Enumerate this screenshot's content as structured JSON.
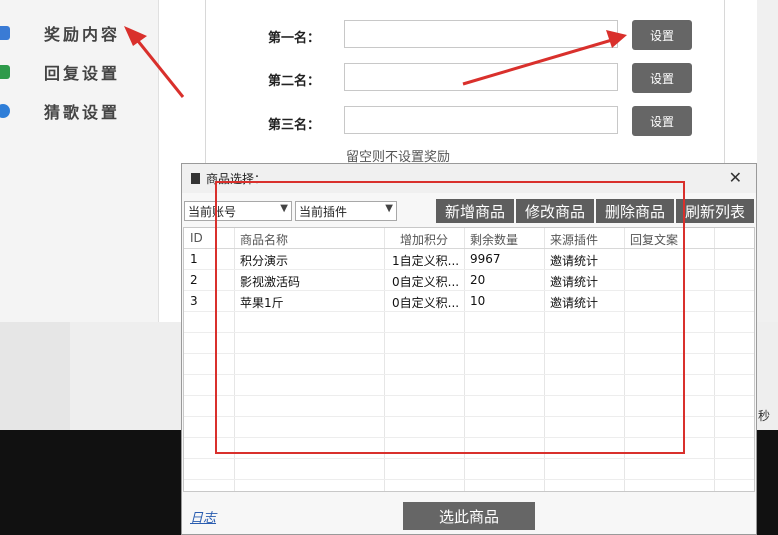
{
  "sidebar": {
    "items": [
      {
        "label": "奖励内容",
        "icon": "cube-icon",
        "color": "#3a7bd5"
      },
      {
        "label": "回复设置",
        "icon": "gift-icon",
        "color": "#2e9a4a"
      },
      {
        "label": "猜歌设置",
        "icon": "gear-icon",
        "color": "#2f7ed8"
      }
    ]
  },
  "rewards": {
    "rows": [
      {
        "label": "第一名：",
        "button": "设置"
      },
      {
        "label": "第二名：",
        "button": "设置"
      },
      {
        "label": "第三名：",
        "button": "设置"
      }
    ],
    "hint": "留空则不设置奖励"
  },
  "side_text": "秒",
  "dialog": {
    "title": "商品选择：",
    "account_select": "当前账号",
    "plugin_select": "当前插件",
    "toolbar": [
      "新增商品",
      "修改商品",
      "删除商品",
      "刷新列表"
    ],
    "columns": [
      "ID",
      "商品名称",
      "增加积分",
      "剩余数量",
      "来源插件",
      "回复文案"
    ],
    "rows": [
      [
        "1",
        "积分演示",
        "1自定义积...",
        "9967",
        "邀请统计",
        ""
      ],
      [
        "2",
        "影视激活码",
        "0自定义积...",
        "20",
        "邀请统计",
        ""
      ],
      [
        "3",
        "苹果1斤",
        "0自定义积...",
        "10",
        "邀请统计",
        ""
      ]
    ],
    "log_link": "日志",
    "select_button": "选此商品"
  },
  "annotation_color": "#d9302c"
}
